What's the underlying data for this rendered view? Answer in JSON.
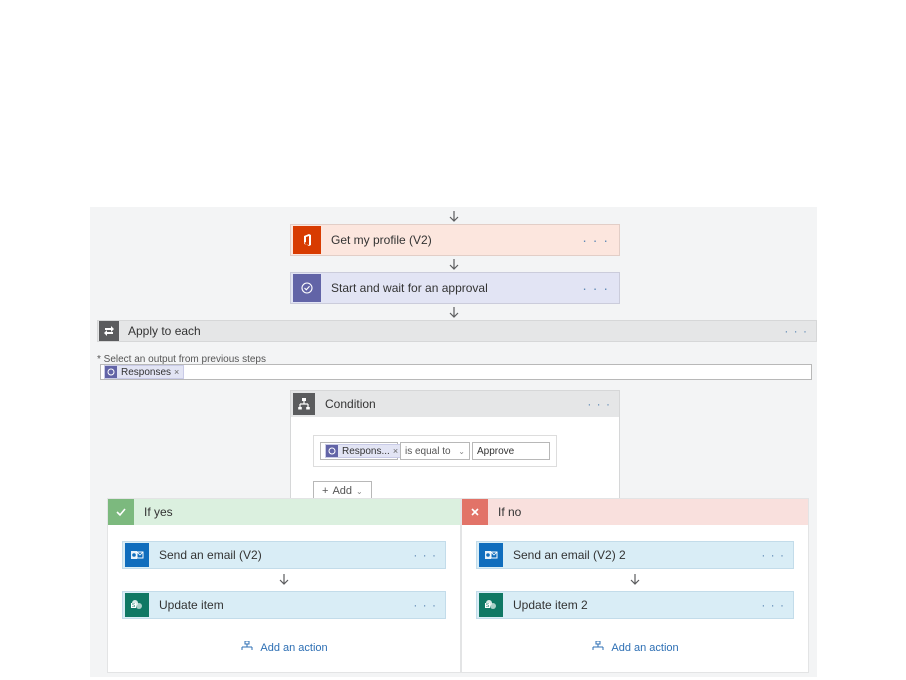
{
  "steps": {
    "profile": {
      "label": "Get my profile (V2)"
    },
    "approval": {
      "label": "Start and wait for an approval"
    },
    "apply": {
      "label": "Apply to each"
    }
  },
  "select_output_label": "* Select an output from previous steps",
  "select_token": "Responses",
  "condition": {
    "title": "Condition",
    "left_token": "Respons...",
    "operator": "is equal to",
    "right_value": "Approve",
    "add_label": "Add"
  },
  "branches": {
    "yes": {
      "title": "If yes",
      "actions": [
        {
          "label": "Send an email (V2)",
          "icon": "outlook"
        },
        {
          "label": "Update item",
          "icon": "sharepoint"
        }
      ],
      "add_action": "Add an action"
    },
    "no": {
      "title": "If no",
      "actions": [
        {
          "label": "Send an email (V2) 2",
          "icon": "outlook"
        },
        {
          "label": "Update item 2",
          "icon": "sharepoint"
        }
      ],
      "add_action": "Add an action"
    }
  }
}
